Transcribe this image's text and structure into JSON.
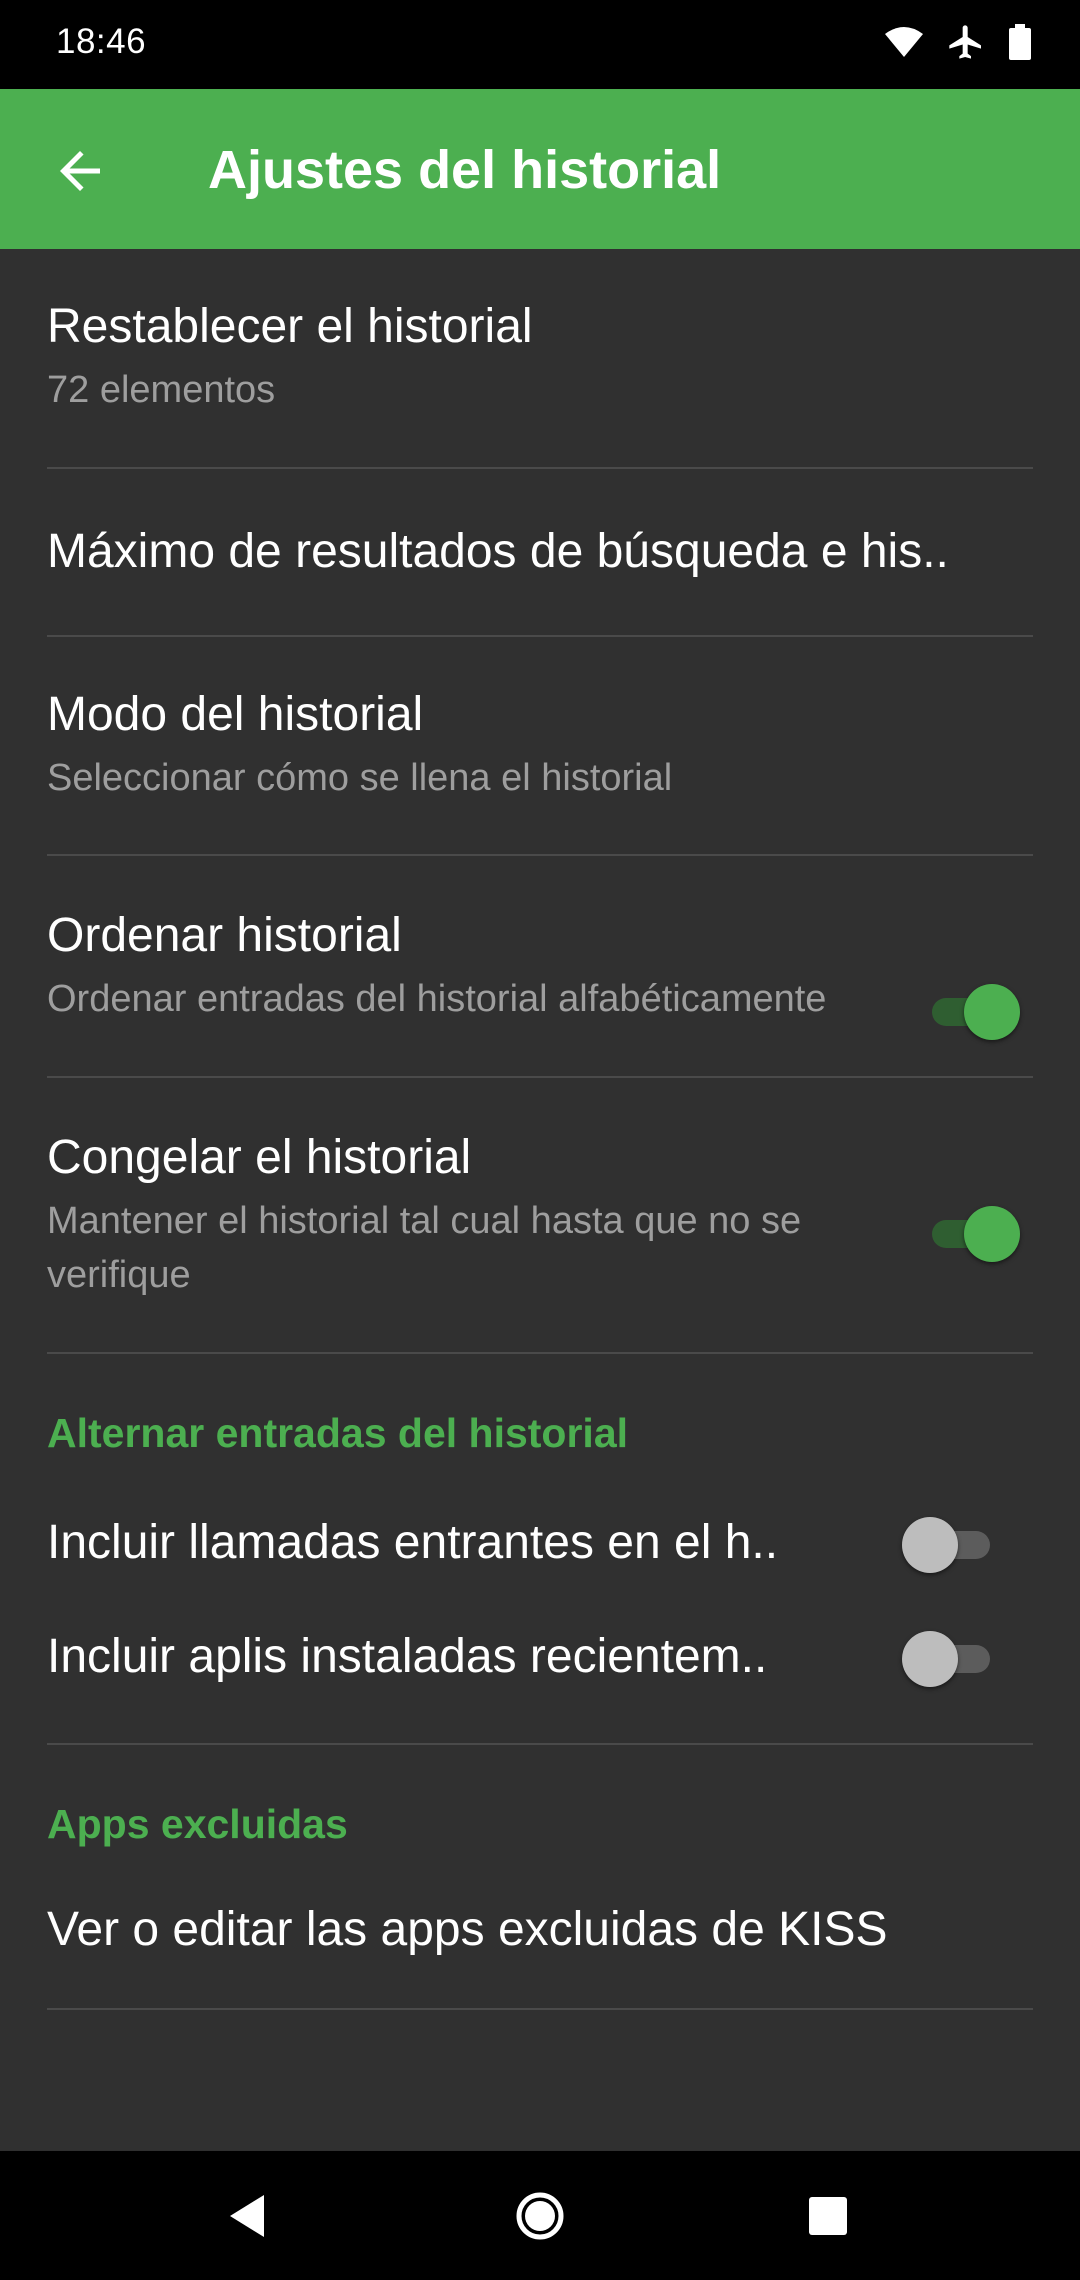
{
  "status": {
    "time": "18:46",
    "icons": [
      "wifi-icon",
      "airplane-icon",
      "battery-icon"
    ]
  },
  "appbar": {
    "back_icon": "arrow-left-icon",
    "title": "Ajustes del historial"
  },
  "prefs": {
    "reset": {
      "title": "Restablecer el historial",
      "summary": "72 elementos"
    },
    "max_results": {
      "title": "Máximo de resultados de búsqueda e his.."
    },
    "mode": {
      "title": "Modo del historial",
      "summary": "Seleccionar cómo se llena el historial"
    },
    "sort": {
      "title": "Ordenar historial",
      "summary": "Ordenar entradas del historial alfabéticamente",
      "enabled": true
    },
    "freeze": {
      "title": "Congelar el historial",
      "summary": "Mantener el historial tal cual hasta que no se verifique",
      "enabled": true
    }
  },
  "section_toggle": {
    "header": "Alternar entradas del historial",
    "incoming_calls": {
      "title": "Incluir llamadas entrantes en el h..",
      "enabled": false
    },
    "recent_apps": {
      "title": "Incluir aplis instaladas recientem..",
      "enabled": false
    }
  },
  "section_excluded": {
    "header": "Apps excluidas",
    "edit": {
      "title": "Ver o editar las apps excluidas de KISS"
    }
  },
  "colors": {
    "accent": "#4caf50",
    "background": "#303030",
    "status_bar": "#000000",
    "secondary_text": "#9e9e9e"
  },
  "navbar": {
    "icons": [
      "back-triangle-icon",
      "home-circle-icon",
      "recents-square-icon"
    ]
  }
}
